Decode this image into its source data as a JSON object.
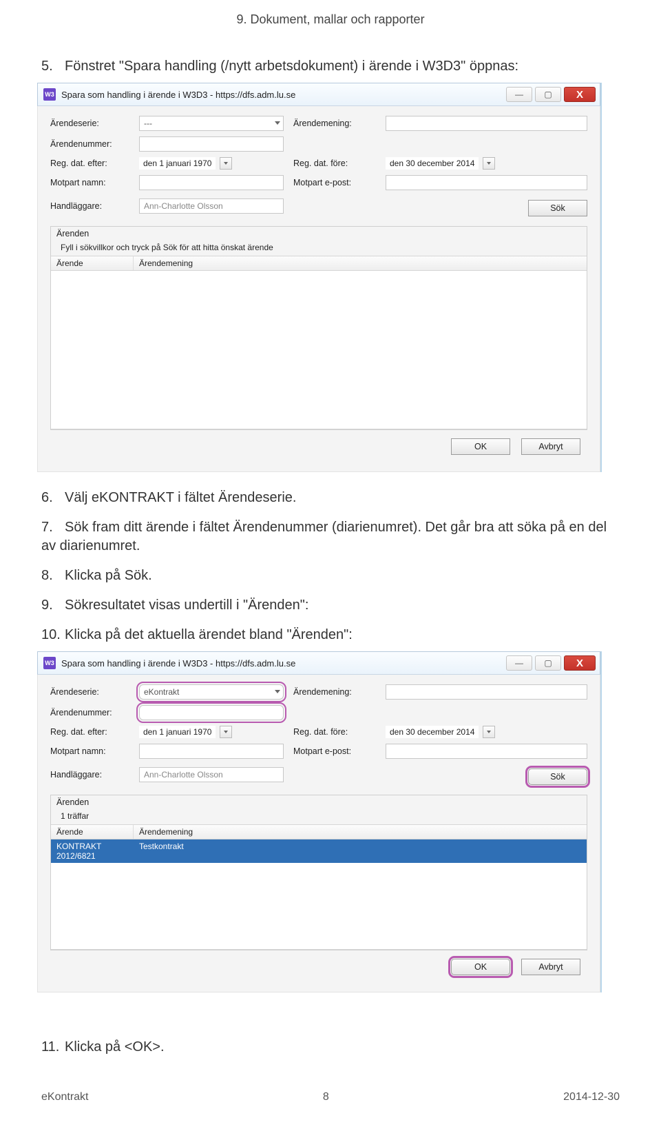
{
  "doc": {
    "header": "9. Dokument, mallar och rapporter",
    "steps": {
      "s5": "Fönstret \"Spara handling (/nytt arbetsdokument) i ärende i W3D3\" öppnas:",
      "s6": "Välj eKONTRAKT i fältet Ärendeserie.",
      "s7": "Sök fram ditt ärende i fältet Ärendenummer (diarienumret). Det går bra att söka på en del av diarienumret.",
      "s8": "Klicka på Sök.",
      "s9": "Sökresultatet visas undertill i \"Ärenden\":",
      "s10": "Klicka på det aktuella ärendet bland \"Ärenden\":",
      "s11": "Klicka på <OK>."
    },
    "footer_left": "eKontrakt",
    "footer_center": "8",
    "footer_right": "2014-12-30"
  },
  "win": {
    "icon": "W3",
    "title": "Spara som handling i ärende i W3D3 - https://dfs.adm.lu.se",
    "min": "—",
    "max": "▢",
    "close": "X"
  },
  "form": {
    "labels": {
      "arendeserie": "Ärendeserie:",
      "arendemening": "Ärendemening:",
      "arendenummer": "Ärendenummer:",
      "reg_efter": "Reg. dat. efter:",
      "reg_fore": "Reg. dat. före:",
      "motpart_namn": "Motpart namn:",
      "motpart_epost": "Motpart e-post:",
      "handlaggare": "Handläggare:"
    },
    "values1": {
      "arendeserie": "---",
      "reg_efter": "den  1   januari   1970",
      "reg_fore": "den 30 december 2014",
      "handlaggare": "Ann-Charlotte Olsson"
    },
    "values2": {
      "arendeserie": "eKontrakt",
      "reg_efter": "den  1   januari   1970",
      "reg_fore": "den 30 december 2014",
      "handlaggare": "Ann-Charlotte Olsson"
    },
    "sok": "Sök",
    "ok": "OK",
    "avbryt": "Avbryt"
  },
  "list": {
    "box_title": "Ärenden",
    "hint1": "Fyll i sökvillkor och tryck på Sök för att hitta önskat ärende",
    "hint2": "1 träffar",
    "col1": "Ärende",
    "col2": "Ärendemening",
    "row_arende": "KONTRAKT 2012/6821",
    "row_mening": "Testkontrakt"
  }
}
